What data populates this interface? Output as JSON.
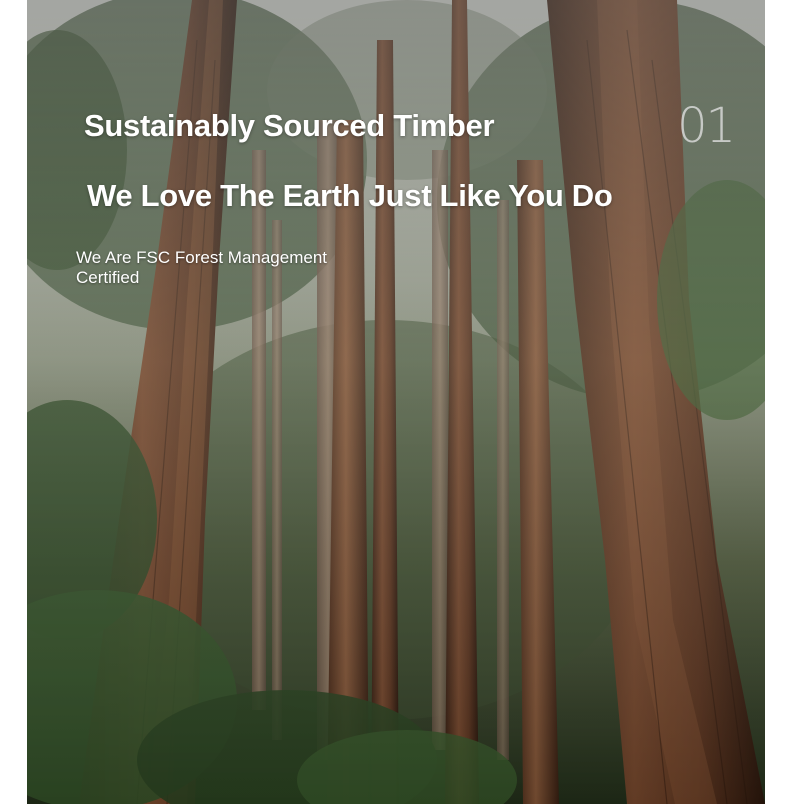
{
  "hero": {
    "title": "Sustainably Sourced Timber",
    "slide_number": "01",
    "subtitle": "We Love The Earth Just Like You Do",
    "certification": "We Are FSC Forest Management Certified",
    "image_subject": "redwood forest"
  },
  "colors": {
    "text": "#ffffff",
    "slide_number": "#e1e1e1",
    "trunk": "#6b3a22",
    "foliage": "#2f4a26"
  }
}
